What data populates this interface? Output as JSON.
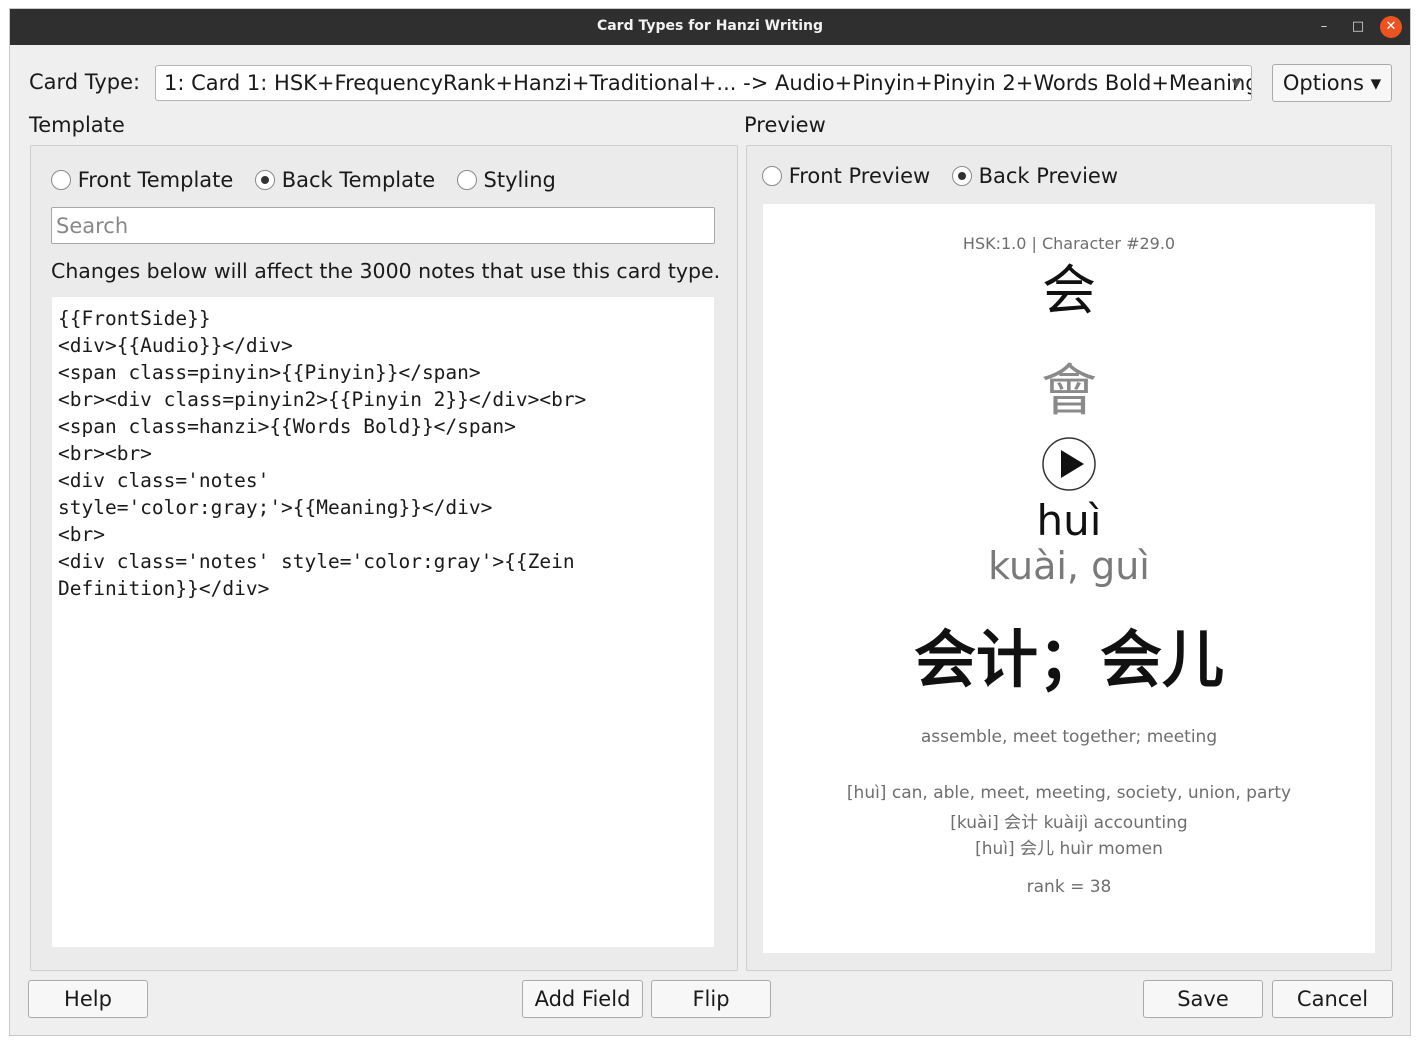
{
  "window": {
    "title": "Card Types for Hanzi Writing",
    "minimize_glyph": "–",
    "maximize_glyph": "□",
    "close_glyph": "✕"
  },
  "card_type": {
    "label": "Card Type:",
    "selected": "1: Card 1: HSK+FrequencyRank+Hanzi+Traditional+... -> Audio+Pinyin+Pinyin 2+Words Bold+Meaning+...",
    "options_label": "Options ▾"
  },
  "template": {
    "heading": "Template",
    "radios": {
      "front": "Front Template",
      "back": "Back Template",
      "styling": "Styling",
      "selected": "back"
    },
    "search_placeholder": "Search",
    "notice": "Changes below will affect the 3000 notes that use this card type.",
    "code": "{{FrontSide}}\n<div>{{Audio}}</div>\n<span class=pinyin>{{Pinyin}}</span>\n<br><div class=pinyin2>{{Pinyin 2}}</div><br>\n<span class=hanzi>{{Words Bold}}</span>\n<br><br>\n<div class='notes'\nstyle='color:gray;'>{{Meaning}}</div>\n<br>\n<div class='notes' style='color:gray'>{{Zein\nDefinition}}</div>"
  },
  "preview": {
    "heading": "Preview",
    "radios": {
      "front": "Front Preview",
      "back": "Back Preview",
      "selected": "back"
    },
    "card": {
      "hsk_line": "HSK:1.0 | Character #29.0",
      "hanzi": "会",
      "traditional": "會",
      "pinyin": "huì",
      "pinyin2": "kuài, guì",
      "words": "会计；会儿",
      "meaning": "assemble, meet together; meeting",
      "definitions": [
        "[huì] can, able, meet, meeting, society, union, party",
        "[kuài] 会计 kuàijì accounting",
        "[huì] 会儿 huìr momen"
      ],
      "rank": "rank = 38"
    }
  },
  "buttons": {
    "help": "Help",
    "add_field": "Add Field",
    "flip": "Flip",
    "save": "Save",
    "cancel": "Cancel"
  },
  "colors": {
    "titlebar": "#2f2f2f",
    "close": "#e95420",
    "window_bg": "#efefef",
    "gray_text": "#6e6e6e"
  },
  "icons": {
    "audio": "play-circle-icon"
  }
}
